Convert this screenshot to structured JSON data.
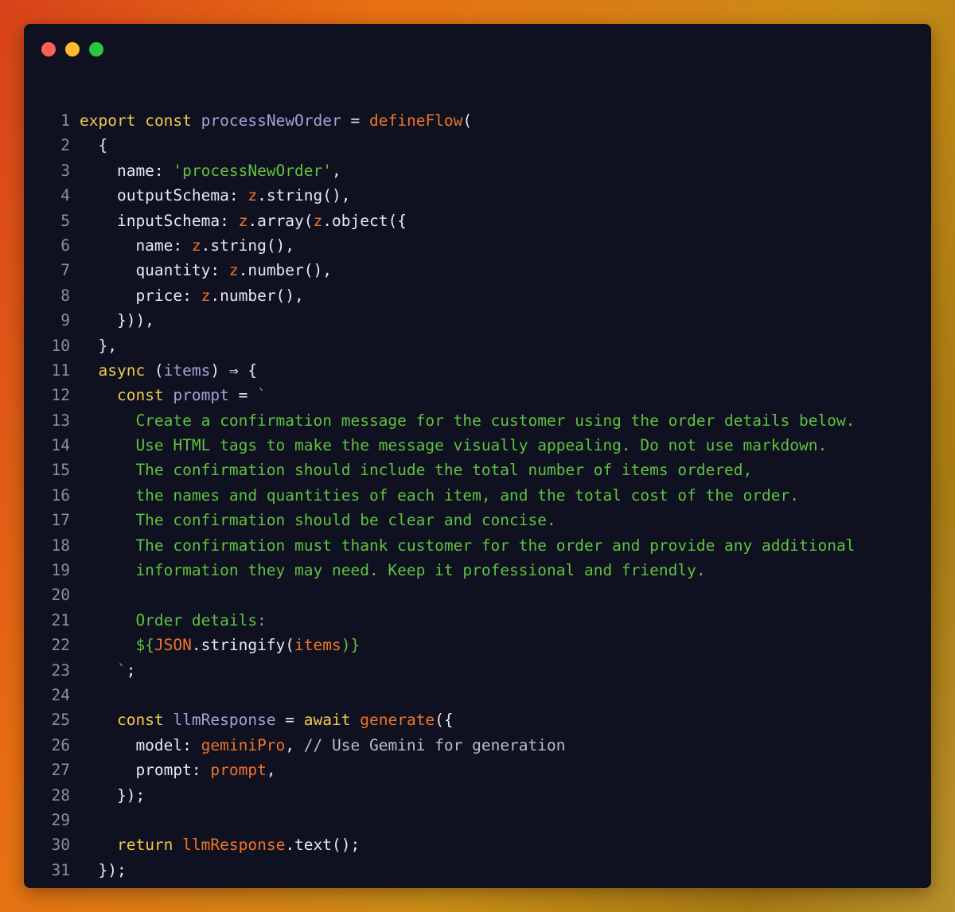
{
  "window": {
    "controls": [
      {
        "name": "close",
        "color": "#ff5f57"
      },
      {
        "name": "minimize",
        "color": "#febc2e"
      },
      {
        "name": "zoom",
        "color": "#28c840"
      }
    ]
  },
  "colors": {
    "keyword": "#f2c94c",
    "function": "#f07428",
    "identifier": "#9fa4d6",
    "string": "#5ec23e",
    "plain": "#e8e8ee",
    "comment": "#b9bccb",
    "line_number": "#8b8fa3"
  },
  "code": {
    "language": "typescript",
    "lines": [
      {
        "n": "1",
        "tokens": [
          [
            "kw",
            "export"
          ],
          [
            "pl",
            " "
          ],
          [
            "kw",
            "const"
          ],
          [
            "pl",
            " "
          ],
          [
            "id",
            "processNewOrder"
          ],
          [
            "pl",
            " = "
          ],
          [
            "fn",
            "defineFlow"
          ],
          [
            "pl",
            "("
          ]
        ]
      },
      {
        "n": "2",
        "tokens": [
          [
            "pl",
            "  {"
          ]
        ]
      },
      {
        "n": "3",
        "tokens": [
          [
            "pl",
            "    name: "
          ],
          [
            "str",
            "'processNewOrder'"
          ],
          [
            "pl",
            ","
          ]
        ]
      },
      {
        "n": "4",
        "tokens": [
          [
            "pl",
            "    outputSchema: "
          ],
          [
            "fn",
            "z"
          ],
          [
            "pl",
            ".string(),"
          ]
        ]
      },
      {
        "n": "5",
        "tokens": [
          [
            "pl",
            "    inputSchema: "
          ],
          [
            "fn",
            "z"
          ],
          [
            "pl",
            ".array("
          ],
          [
            "fn",
            "z"
          ],
          [
            "pl",
            ".object({"
          ]
        ]
      },
      {
        "n": "6",
        "tokens": [
          [
            "pl",
            "      name: "
          ],
          [
            "fn",
            "z"
          ],
          [
            "pl",
            ".string(),"
          ]
        ]
      },
      {
        "n": "7",
        "tokens": [
          [
            "pl",
            "      quantity: "
          ],
          [
            "fn",
            "z"
          ],
          [
            "pl",
            ".number(),"
          ]
        ]
      },
      {
        "n": "8",
        "tokens": [
          [
            "pl",
            "      price: "
          ],
          [
            "fn",
            "z"
          ],
          [
            "pl",
            ".number(),"
          ]
        ]
      },
      {
        "n": "9",
        "tokens": [
          [
            "pl",
            "    })),"
          ]
        ]
      },
      {
        "n": "10",
        "tokens": [
          [
            "pl",
            "  },"
          ]
        ]
      },
      {
        "n": "11",
        "tokens": [
          [
            "pl",
            "  "
          ],
          [
            "kw",
            "async"
          ],
          [
            "pl",
            " ("
          ],
          [
            "id",
            "items"
          ],
          [
            "pl",
            ") ⇒ {"
          ]
        ]
      },
      {
        "n": "12",
        "tokens": [
          [
            "pl",
            "    "
          ],
          [
            "kw",
            "const"
          ],
          [
            "pl",
            " "
          ],
          [
            "id",
            "prompt"
          ],
          [
            "pl",
            " = "
          ],
          [
            "str",
            "`"
          ]
        ]
      },
      {
        "n": "13",
        "tokens": [
          [
            "str",
            "      Create a confirmation message for the customer using the order details below."
          ]
        ]
      },
      {
        "n": "14",
        "tokens": [
          [
            "str",
            "      Use HTML tags to make the message visually appealing. Do not use markdown."
          ]
        ]
      },
      {
        "n": "15",
        "tokens": [
          [
            "str",
            "      The confirmation should include the total number of items ordered,"
          ]
        ]
      },
      {
        "n": "16",
        "tokens": [
          [
            "str",
            "      the names and quantities of each item, and the total cost of the order."
          ]
        ]
      },
      {
        "n": "17",
        "tokens": [
          [
            "str",
            "      The confirmation should be clear and concise."
          ]
        ]
      },
      {
        "n": "18",
        "tokens": [
          [
            "str",
            "      The confirmation must thank customer for the order and provide any additional"
          ]
        ]
      },
      {
        "n": "19",
        "tokens": [
          [
            "str",
            "      information they may need. Keep it professional and friendly."
          ]
        ]
      },
      {
        "n": "20",
        "tokens": []
      },
      {
        "n": "21",
        "tokens": [
          [
            "str",
            "      Order details:"
          ]
        ]
      },
      {
        "n": "22",
        "tokens": [
          [
            "str",
            "      ${"
          ],
          [
            "fn",
            "JSON"
          ],
          [
            "pl",
            ".stringify("
          ],
          [
            "fn",
            "items"
          ],
          [
            "str",
            ")}"
          ]
        ]
      },
      {
        "n": "23",
        "tokens": [
          [
            "str",
            "    `"
          ],
          [
            "pl",
            ";"
          ]
        ]
      },
      {
        "n": "24",
        "tokens": []
      },
      {
        "n": "25",
        "tokens": [
          [
            "pl",
            "    "
          ],
          [
            "kw",
            "const"
          ],
          [
            "pl",
            " "
          ],
          [
            "id",
            "llmResponse"
          ],
          [
            "pl",
            " = "
          ],
          [
            "kw",
            "await"
          ],
          [
            "pl",
            " "
          ],
          [
            "fn",
            "generate"
          ],
          [
            "pl",
            "({"
          ]
        ]
      },
      {
        "n": "26",
        "tokens": [
          [
            "pl",
            "      model: "
          ],
          [
            "fn",
            "geminiPro"
          ],
          [
            "pl",
            ", "
          ],
          [
            "cm",
            "// Use Gemini for generation"
          ]
        ]
      },
      {
        "n": "27",
        "tokens": [
          [
            "pl",
            "      prompt: "
          ],
          [
            "fn",
            "prompt"
          ],
          [
            "pl",
            ","
          ]
        ]
      },
      {
        "n": "28",
        "tokens": [
          [
            "pl",
            "    });"
          ]
        ]
      },
      {
        "n": "29",
        "tokens": []
      },
      {
        "n": "30",
        "tokens": [
          [
            "pl",
            "    "
          ],
          [
            "kw",
            "return"
          ],
          [
            "pl",
            " "
          ],
          [
            "fn",
            "llmResponse"
          ],
          [
            "pl",
            ".text();"
          ]
        ]
      },
      {
        "n": "31",
        "tokens": [
          [
            "pl",
            "  });"
          ]
        ]
      }
    ]
  }
}
